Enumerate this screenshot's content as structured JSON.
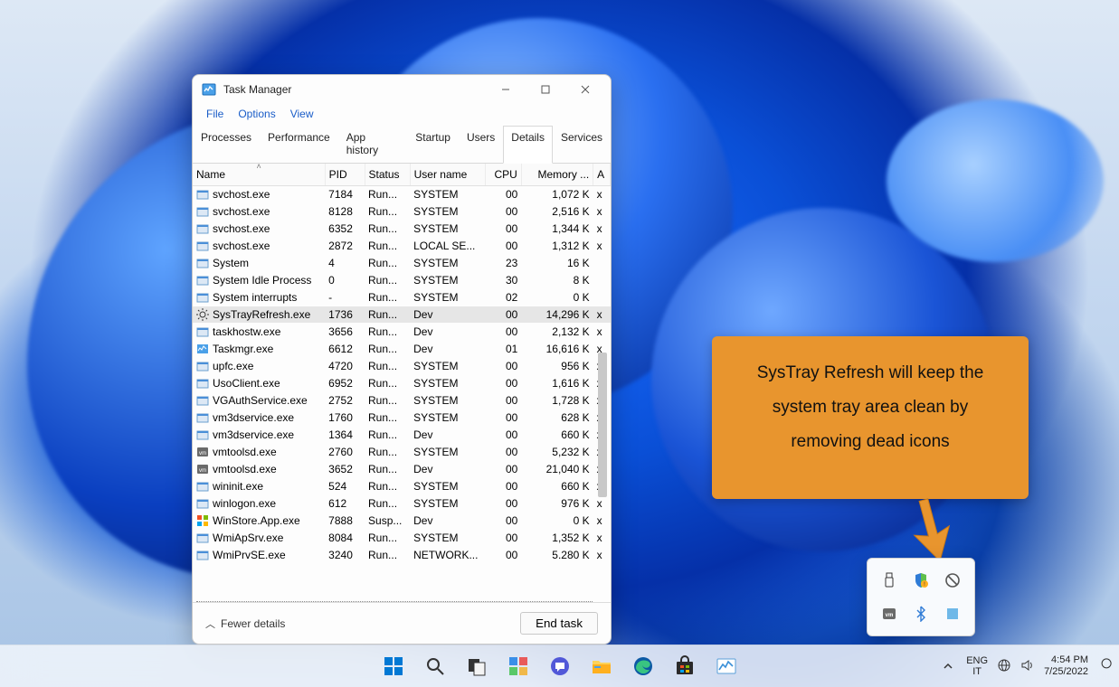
{
  "window": {
    "title": "Task Manager",
    "menus": [
      "File",
      "Options",
      "View"
    ],
    "tabs": [
      "Processes",
      "Performance",
      "App history",
      "Startup",
      "Users",
      "Details",
      "Services"
    ],
    "active_tab": "Details",
    "columns": [
      "Name",
      "PID",
      "Status",
      "User name",
      "CPU",
      "Memory ...",
      "A"
    ],
    "sort_column": "Name",
    "fewer_label": "Fewer details",
    "end_task_label": "End task"
  },
  "rows": [
    {
      "icon": "svc",
      "name": "svchost.exe",
      "pid": "7184",
      "status": "Run...",
      "user": "SYSTEM",
      "cpu": "00",
      "mem": "1,072 K",
      "a": "x"
    },
    {
      "icon": "svc",
      "name": "svchost.exe",
      "pid": "8128",
      "status": "Run...",
      "user": "SYSTEM",
      "cpu": "00",
      "mem": "2,516 K",
      "a": "x"
    },
    {
      "icon": "svc",
      "name": "svchost.exe",
      "pid": "6352",
      "status": "Run...",
      "user": "SYSTEM",
      "cpu": "00",
      "mem": "1,344 K",
      "a": "x"
    },
    {
      "icon": "svc",
      "name": "svchost.exe",
      "pid": "2872",
      "status": "Run...",
      "user": "LOCAL SE...",
      "cpu": "00",
      "mem": "1,312 K",
      "a": "x"
    },
    {
      "icon": "sys",
      "name": "System",
      "pid": "4",
      "status": "Run...",
      "user": "SYSTEM",
      "cpu": "23",
      "mem": "16 K",
      "a": ""
    },
    {
      "icon": "sys",
      "name": "System Idle Process",
      "pid": "0",
      "status": "Run...",
      "user": "SYSTEM",
      "cpu": "30",
      "mem": "8 K",
      "a": ""
    },
    {
      "icon": "sys",
      "name": "System interrupts",
      "pid": "-",
      "status": "Run...",
      "user": "SYSTEM",
      "cpu": "02",
      "mem": "0 K",
      "a": ""
    },
    {
      "icon": "gear",
      "name": "SysTrayRefresh.exe",
      "pid": "1736",
      "status": "Run...",
      "user": "Dev",
      "cpu": "00",
      "mem": "14,296 K",
      "a": "x",
      "selected": true
    },
    {
      "icon": "svc",
      "name": "taskhostw.exe",
      "pid": "3656",
      "status": "Run...",
      "user": "Dev",
      "cpu": "00",
      "mem": "2,132 K",
      "a": "x"
    },
    {
      "icon": "tm",
      "name": "Taskmgr.exe",
      "pid": "6612",
      "status": "Run...",
      "user": "Dev",
      "cpu": "01",
      "mem": "16,616 K",
      "a": "x"
    },
    {
      "icon": "svc",
      "name": "upfc.exe",
      "pid": "4720",
      "status": "Run...",
      "user": "SYSTEM",
      "cpu": "00",
      "mem": "956 K",
      "a": "x"
    },
    {
      "icon": "svc",
      "name": "UsoClient.exe",
      "pid": "6952",
      "status": "Run...",
      "user": "SYSTEM",
      "cpu": "00",
      "mem": "1,616 K",
      "a": "x"
    },
    {
      "icon": "svc",
      "name": "VGAuthService.exe",
      "pid": "2752",
      "status": "Run...",
      "user": "SYSTEM",
      "cpu": "00",
      "mem": "1,728 K",
      "a": "x"
    },
    {
      "icon": "svc",
      "name": "vm3dservice.exe",
      "pid": "1760",
      "status": "Run...",
      "user": "SYSTEM",
      "cpu": "00",
      "mem": "628 K",
      "a": "x"
    },
    {
      "icon": "svc",
      "name": "vm3dservice.exe",
      "pid": "1364",
      "status": "Run...",
      "user": "Dev",
      "cpu": "00",
      "mem": "660 K",
      "a": "x"
    },
    {
      "icon": "vm",
      "name": "vmtoolsd.exe",
      "pid": "2760",
      "status": "Run...",
      "user": "SYSTEM",
      "cpu": "00",
      "mem": "5,232 K",
      "a": "x"
    },
    {
      "icon": "vm",
      "name": "vmtoolsd.exe",
      "pid": "3652",
      "status": "Run...",
      "user": "Dev",
      "cpu": "00",
      "mem": "21,040 K",
      "a": "x"
    },
    {
      "icon": "svc",
      "name": "wininit.exe",
      "pid": "524",
      "status": "Run...",
      "user": "SYSTEM",
      "cpu": "00",
      "mem": "660 K",
      "a": "x"
    },
    {
      "icon": "svc",
      "name": "winlogon.exe",
      "pid": "612",
      "status": "Run...",
      "user": "SYSTEM",
      "cpu": "00",
      "mem": "976 K",
      "a": "x"
    },
    {
      "icon": "app",
      "name": "WinStore.App.exe",
      "pid": "7888",
      "status": "Susp...",
      "user": "Dev",
      "cpu": "00",
      "mem": "0 K",
      "a": "x"
    },
    {
      "icon": "svc",
      "name": "WmiApSrv.exe",
      "pid": "8084",
      "status": "Run...",
      "user": "SYSTEM",
      "cpu": "00",
      "mem": "1,352 K",
      "a": "x"
    },
    {
      "icon": "svc",
      "name": "WmiPrvSE.exe",
      "pid": "3240",
      "status": "Run...",
      "user": "NETWORK...",
      "cpu": "00",
      "mem": "5.280 K",
      "a": "x"
    }
  ],
  "callout": {
    "text": "SysTray Refresh will keep the system tray area clean by removing dead icons"
  },
  "systray_icons": [
    "usb-icon",
    "security-shield-icon",
    "do-not-disturb-icon",
    "vmware-icon",
    "bluetooth-icon",
    "systray-refresh-icon"
  ],
  "taskbar": {
    "pinned": [
      "start",
      "search",
      "task-view",
      "widgets",
      "chat",
      "explorer",
      "edge",
      "store",
      "task-manager"
    ],
    "lang1": "ENG",
    "lang2": "IT",
    "time": "4:54 PM",
    "date": "7/25/2022"
  }
}
